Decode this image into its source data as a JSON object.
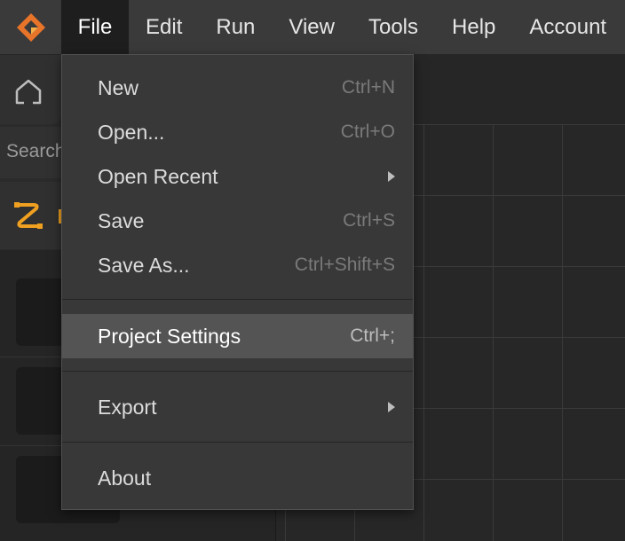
{
  "menubar": {
    "items": [
      {
        "label": "File"
      },
      {
        "label": "Edit"
      },
      {
        "label": "Run"
      },
      {
        "label": "View"
      },
      {
        "label": "Tools"
      },
      {
        "label": "Help"
      },
      {
        "label": "Account"
      }
    ]
  },
  "left_panel": {
    "search_placeholder": "Search"
  },
  "file_menu": {
    "items": [
      {
        "label": "New",
        "shortcut": "Ctrl+N"
      },
      {
        "label": "Open...",
        "shortcut": "Ctrl+O"
      },
      {
        "label": "Open Recent",
        "shortcut": ""
      },
      {
        "label": "Save",
        "shortcut": "Ctrl+S"
      },
      {
        "label": "Save As...",
        "shortcut": "Ctrl+Shift+S"
      },
      {
        "label": "Project Settings",
        "shortcut": "Ctrl+;"
      },
      {
        "label": "Export",
        "shortcut": ""
      },
      {
        "label": "About",
        "shortcut": ""
      }
    ],
    "highlighted_item": "Project Settings"
  },
  "colors": {
    "accent": "#f0a020",
    "logo_orange": "#e8742a",
    "menu_background": "#383838",
    "highlight": "#545454"
  }
}
